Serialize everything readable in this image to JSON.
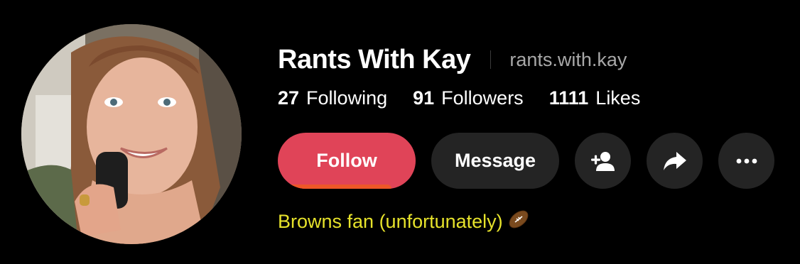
{
  "profile": {
    "display_name": "Rants With Kay",
    "username": "rants.with.kay",
    "bio": "Browns fan (unfortunately)",
    "bio_emoji": "football-emoji"
  },
  "stats": {
    "following_count": "27",
    "following_label": "Following",
    "followers_count": "91",
    "followers_label": "Followers",
    "likes_count": "1111",
    "likes_label": "Likes"
  },
  "actions": {
    "follow_label": "Follow",
    "message_label": "Message",
    "add_friend_icon": "add-user-icon",
    "share_icon": "share-icon",
    "more_icon": "more-icon"
  },
  "colors": {
    "background": "#000000",
    "follow_button": "#e04458",
    "secondary_button": "#242424",
    "bio_text": "#e6e22b",
    "username_text": "#a8a8a8"
  }
}
